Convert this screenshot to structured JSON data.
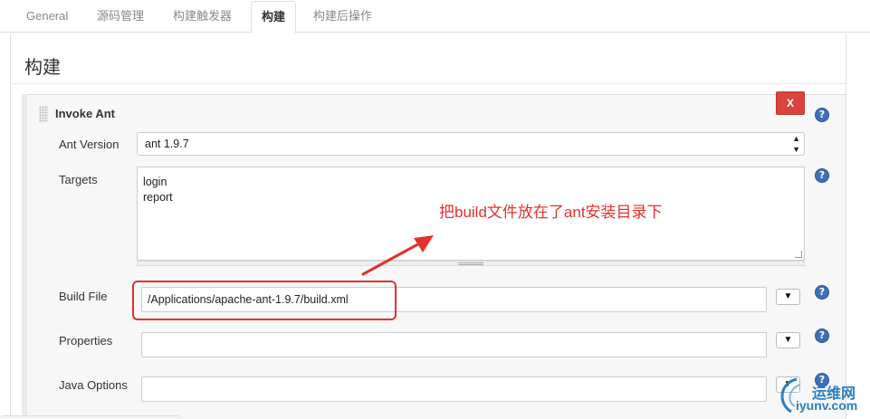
{
  "tabs": [
    {
      "label": "General"
    },
    {
      "label": "源码管理"
    },
    {
      "label": "构建触发器"
    },
    {
      "label": "构建",
      "active": true
    },
    {
      "label": "构建后操作"
    }
  ],
  "section": {
    "title": "构建"
  },
  "step": {
    "title": "Invoke Ant",
    "delete_label": "X",
    "help_glyph": "?",
    "fields": {
      "ant_version": {
        "label": "Ant Version",
        "value": "ant 1.9.7"
      },
      "targets": {
        "label": "Targets",
        "value": "login\nreport"
      },
      "build_file": {
        "label": "Build File",
        "value": "/Applications/apache-ant-1.9.7/build.xml"
      },
      "properties": {
        "label": "Properties",
        "value": ""
      },
      "java_options": {
        "label": "Java Options",
        "value": ""
      }
    },
    "expand_glyph": "▼",
    "select_arrow": "▲\n▼"
  },
  "annotation": {
    "text": "把build文件放在了ant安装目录下",
    "color": "#e3312d"
  },
  "watermark": {
    "text": "运维网",
    "sub": "iyunv.com",
    "color": "#2a7fc2"
  },
  "colors": {
    "accent_delete": "#d9453b",
    "help_blue": "#3f6fb5"
  }
}
